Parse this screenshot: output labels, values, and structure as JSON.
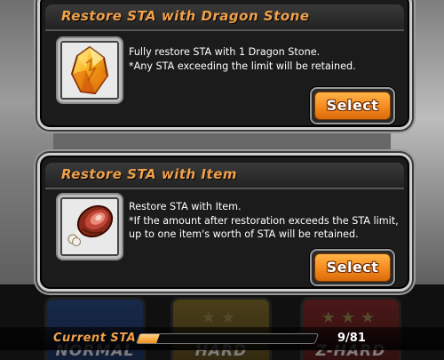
{
  "dragon_stone_panel": {
    "title": "Restore STA with Dragon Stone",
    "desc_line1": "Fully restore STA with 1 Dragon Stone.",
    "desc_line2": "*Any STA exceeding the limit will be retained.",
    "select_label": "Select",
    "icon": "dragon-stone-icon"
  },
  "item_panel": {
    "title": "Restore STA with Item",
    "desc_line1": "Restore STA with Item.",
    "desc_line2": "*If the amount after restoration exceeds the STA limit,",
    "desc_line3": "up to one item's worth of STA will be retained.",
    "select_label": "Select",
    "icon": "meat-icon"
  },
  "sta_bar": {
    "label": "Current STA",
    "value": "9/81",
    "current": 9,
    "max": 81
  },
  "difficulty_tabs": [
    {
      "label": "NORMAL"
    },
    {
      "label": "HARD"
    },
    {
      "label": "Z-HARD"
    }
  ],
  "colors": {
    "accent_title": "#f0a14a",
    "button_orange": "#f58a1f",
    "panel_bg": "#1b1b1b"
  }
}
